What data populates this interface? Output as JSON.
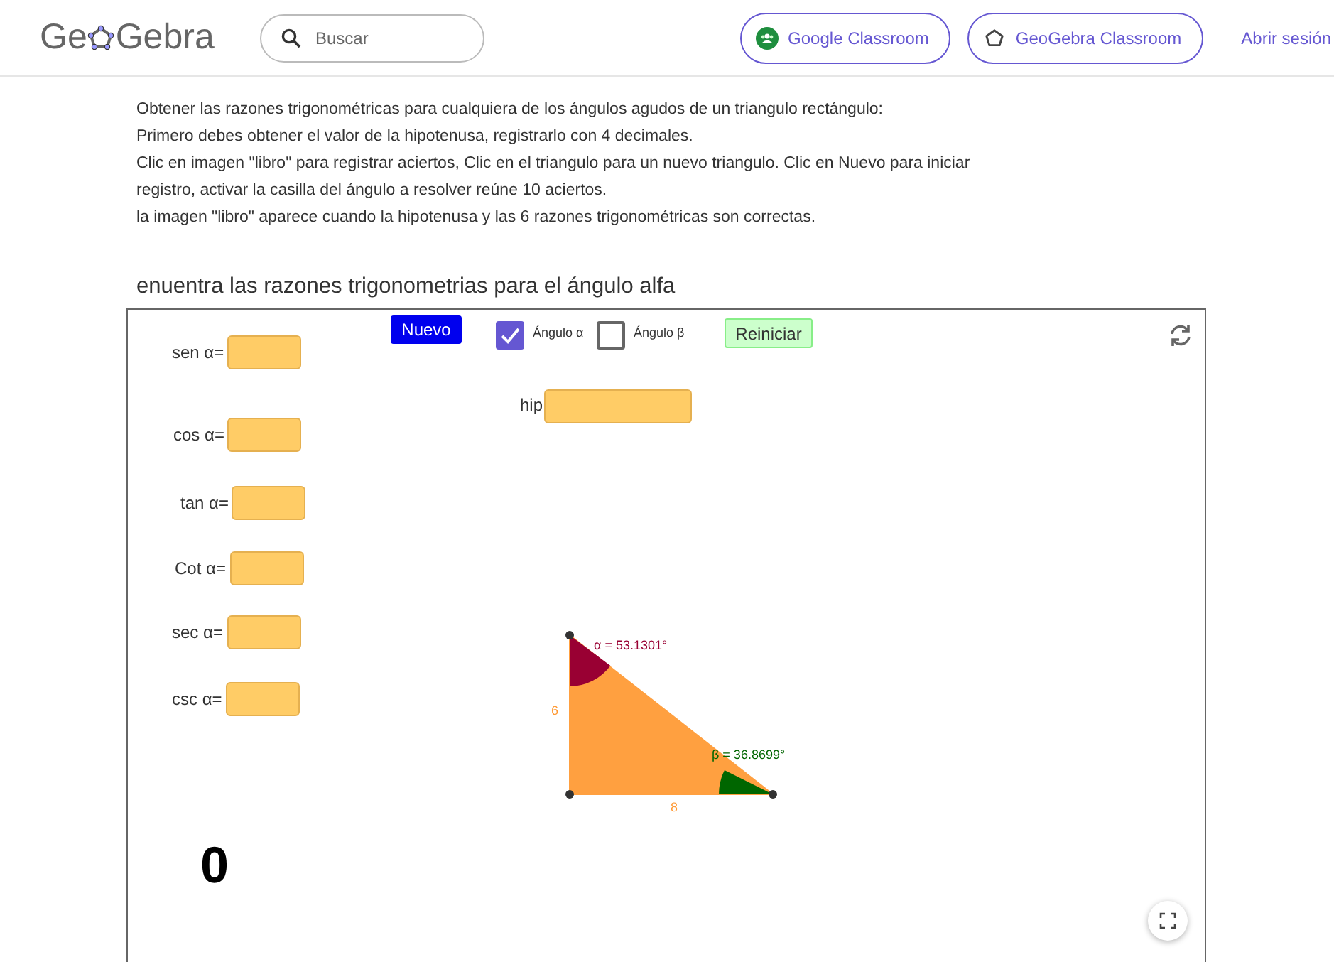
{
  "header": {
    "logo_parts": [
      "Ge",
      "Gebra"
    ],
    "search": {
      "placeholder": "Buscar"
    },
    "buttons": [
      {
        "label": "Google Classroom",
        "kind": "google"
      },
      {
        "label": "GeoGebra Classroom",
        "kind": "geogebra"
      }
    ],
    "sign_in": "Abrir sesión"
  },
  "instructions": [
    "Obtener las razones trigonométricas para cualquiera de los  ángulos agudos de un triangulo rectángulo:",
    "Primero debes obtener el valor de la hipotenusa, registrarlo con 4 decimales.",
    "Clic en imagen \"libro\" para registrar aciertos, Clic en el triangulo para un nuevo triangulo. Clic en Nuevo para iniciar",
    "registro, activar la casilla del ángulo a resolver reúne 10 aciertos.",
    "la imagen \"libro\" aparece cuando la hipotenusa y las 6 razones trigonométricas son correctas."
  ],
  "applet_title": "enuentra las razones trigonometrias para el ángulo alfa",
  "applet": {
    "fields": [
      {
        "label": "sen α="
      },
      {
        "label": "cos α="
      },
      {
        "label": "tan α="
      },
      {
        "label": "Cot α="
      },
      {
        "label": "sec α="
      },
      {
        "label": "csc α="
      }
    ],
    "new_button": "Nuevo",
    "checkboxes": [
      {
        "label": "Ángulo α",
        "checked": true
      },
      {
        "label": "Ángulo β",
        "checked": false
      }
    ],
    "reset_button": "Reiniciar",
    "hyp_label": "hip",
    "triangle": {
      "alpha_label": "α = 53.1301°",
      "beta_label": "β = 36.8699°",
      "side_vertical": "6",
      "side_horizontal": "8"
    },
    "score": "0"
  }
}
